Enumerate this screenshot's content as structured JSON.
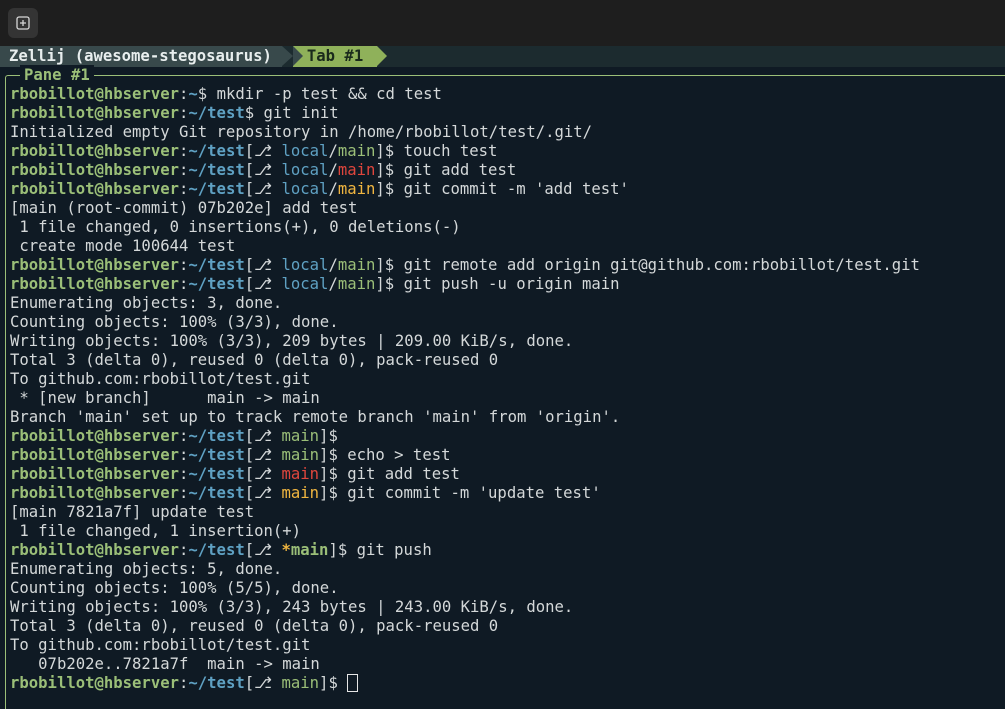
{
  "window": {
    "new_tab_icon": "new-pane-icon"
  },
  "statusbar": {
    "session": "Zellij (awesome-stegosaurus)",
    "tab": "Tab #1"
  },
  "pane": {
    "title": "Pane #1"
  },
  "prompt": {
    "user_host": "rbobillot@hbserver",
    "colon": ":",
    "home": "~",
    "test_dir": "~/test",
    "dollar": "$ ",
    "branch_icon": "⎇",
    "open": "[",
    "close": "]",
    "remote": "local",
    "slash": "/"
  },
  "lines": [
    {
      "kind": "prompt",
      "path": "~",
      "cmd": "mkdir -p test && cd test"
    },
    {
      "kind": "prompt",
      "path": "~/test",
      "cmd": "git init"
    },
    {
      "kind": "text",
      "text": "Initialized empty Git repository in /home/rbobillot/test/.git/"
    },
    {
      "kind": "gitprompt",
      "remote": "local",
      "branch": "main",
      "state": "clean",
      "cmd": "touch test"
    },
    {
      "kind": "gitprompt",
      "remote": "local",
      "branch": "main",
      "state": "dirty",
      "cmd": "git add test"
    },
    {
      "kind": "gitprompt",
      "remote": "local",
      "branch": "main",
      "state": "staged",
      "cmd": "git commit -m 'add test'"
    },
    {
      "kind": "text",
      "text": "[main (root-commit) 07b202e] add test"
    },
    {
      "kind": "text",
      "text": " 1 file changed, 0 insertions(+), 0 deletions(-)"
    },
    {
      "kind": "text",
      "text": " create mode 100644 test"
    },
    {
      "kind": "gitprompt",
      "remote": "local",
      "branch": "main",
      "state": "clean",
      "cmd": "git remote add origin git@github.com:rbobillot/test.git"
    },
    {
      "kind": "gitprompt",
      "remote": "local",
      "branch": "main",
      "state": "clean",
      "cmd": "git push -u origin main"
    },
    {
      "kind": "text",
      "text": "Enumerating objects: 3, done."
    },
    {
      "kind": "text",
      "text": "Counting objects: 100% (3/3), done."
    },
    {
      "kind": "text",
      "text": "Writing objects: 100% (3/3), 209 bytes | 209.00 KiB/s, done."
    },
    {
      "kind": "text",
      "text": "Total 3 (delta 0), reused 0 (delta 0), pack-reused 0"
    },
    {
      "kind": "text",
      "text": "To github.com:rbobillot/test.git"
    },
    {
      "kind": "text",
      "text": " * [new branch]      main -> main"
    },
    {
      "kind": "text",
      "text": "Branch 'main' set up to track remote branch 'main' from 'origin'."
    },
    {
      "kind": "gitprompt",
      "branch": "main",
      "state": "clean",
      "cmd": ""
    },
    {
      "kind": "gitprompt",
      "branch": "main",
      "state": "clean",
      "cmd": "echo > test"
    },
    {
      "kind": "gitprompt",
      "branch": "main",
      "state": "dirty",
      "cmd": "git add test"
    },
    {
      "kind": "gitprompt",
      "branch": "main",
      "state": "staged",
      "cmd": "git commit -m 'update test'"
    },
    {
      "kind": "text",
      "text": "[main 7821a7f] update test"
    },
    {
      "kind": "text",
      "text": " 1 file changed, 1 insertion(+)"
    },
    {
      "kind": "gitprompt",
      "branch": "main",
      "state": "ahead",
      "marker": "*",
      "cmd": "git push"
    },
    {
      "kind": "text",
      "text": "Enumerating objects: 5, done."
    },
    {
      "kind": "text",
      "text": "Counting objects: 100% (5/5), done."
    },
    {
      "kind": "text",
      "text": "Writing objects: 100% (3/3), 243 bytes | 243.00 KiB/s, done."
    },
    {
      "kind": "text",
      "text": "Total 3 (delta 0), reused 0 (delta 0), pack-reused 0"
    },
    {
      "kind": "text",
      "text": "To github.com:rbobillot/test.git"
    },
    {
      "kind": "text",
      "text": "   07b202e..7821a7f  main -> main"
    },
    {
      "kind": "gitprompt",
      "branch": "main",
      "state": "clean",
      "cmd": "",
      "cursor": true
    }
  ],
  "colors": {
    "background": "#0f1a24",
    "user": "#9bbf78",
    "path": "#5fa1c3",
    "dirty": "#e0463d",
    "staged": "#f1b640",
    "tab": "#8fb15a"
  }
}
